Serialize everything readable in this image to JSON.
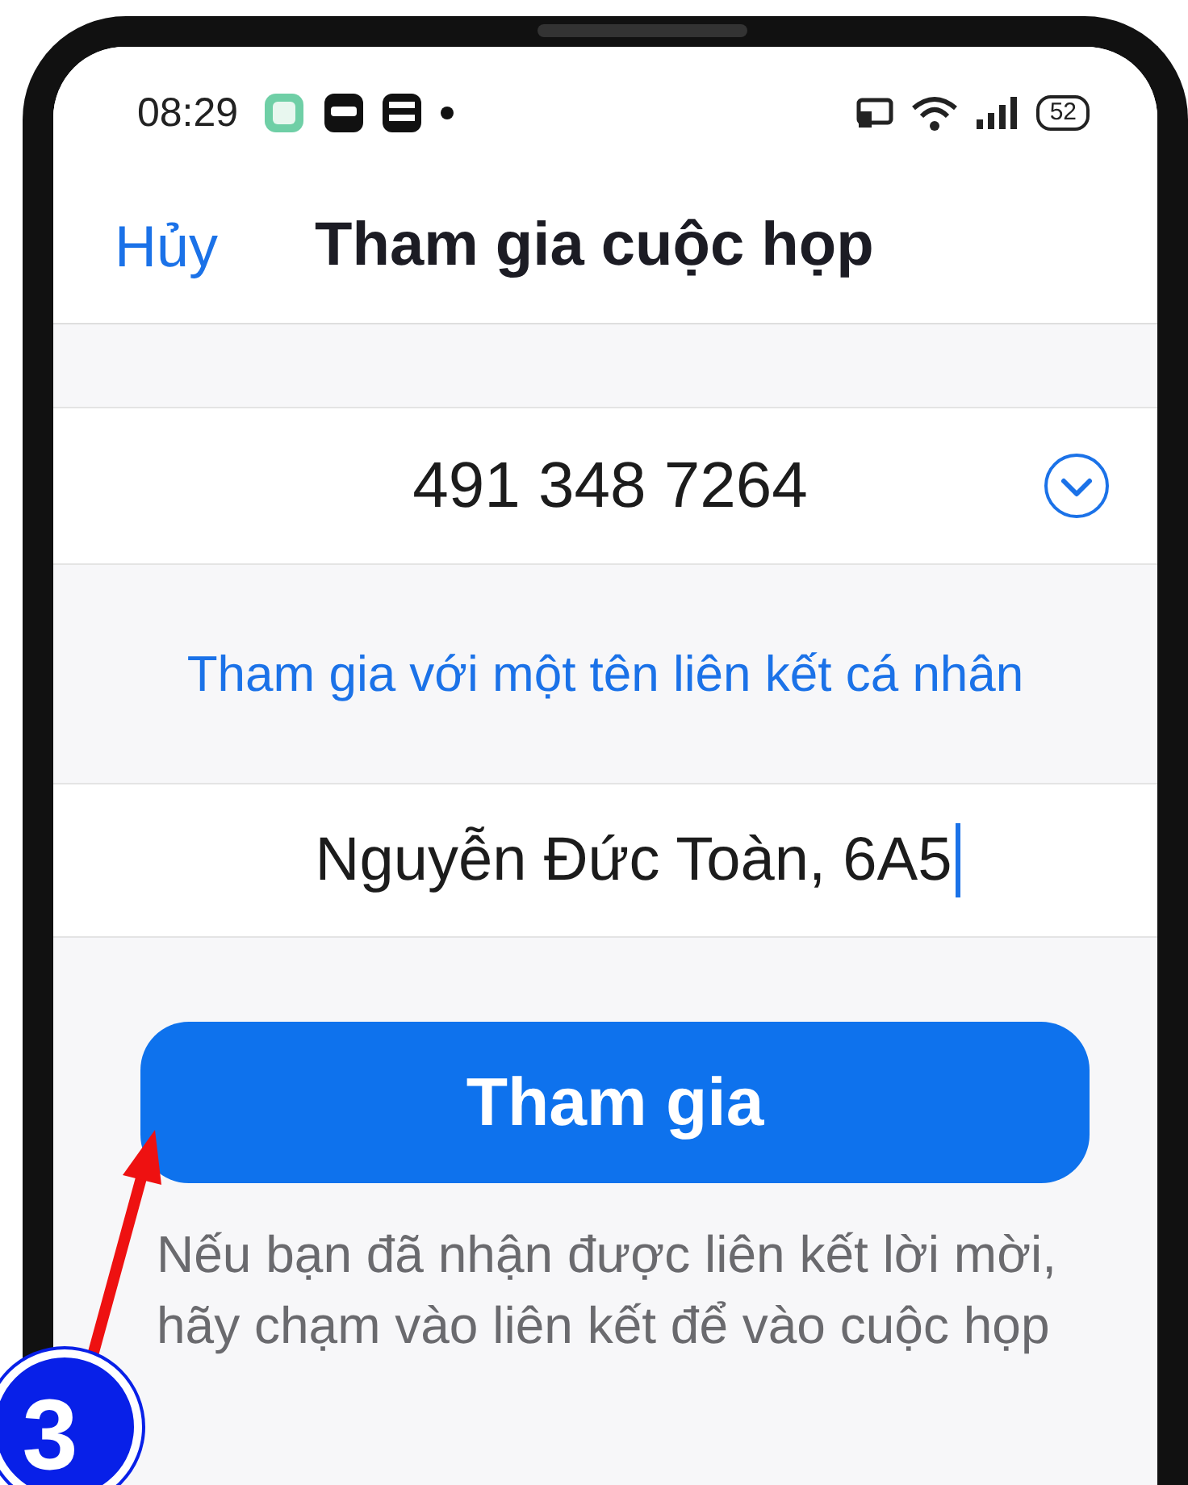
{
  "status_bar": {
    "time": "08:29",
    "battery": "52"
  },
  "header": {
    "cancel": "Hủy",
    "title": "Tham gia cuộc họp"
  },
  "meeting_id": {
    "value": "491 348 7264"
  },
  "personal_link": "Tham gia với một tên liên kết cá nhân",
  "name_field": {
    "value": "Nguyễn Đức Toàn, 6A5",
    "focused": true
  },
  "join_button": "Tham gia",
  "help_text": "Nếu bạn đã nhận được liên kết lời mời, hãy chạm vào liên kết để vào cuộc họp",
  "annotation": {
    "step": "3"
  }
}
